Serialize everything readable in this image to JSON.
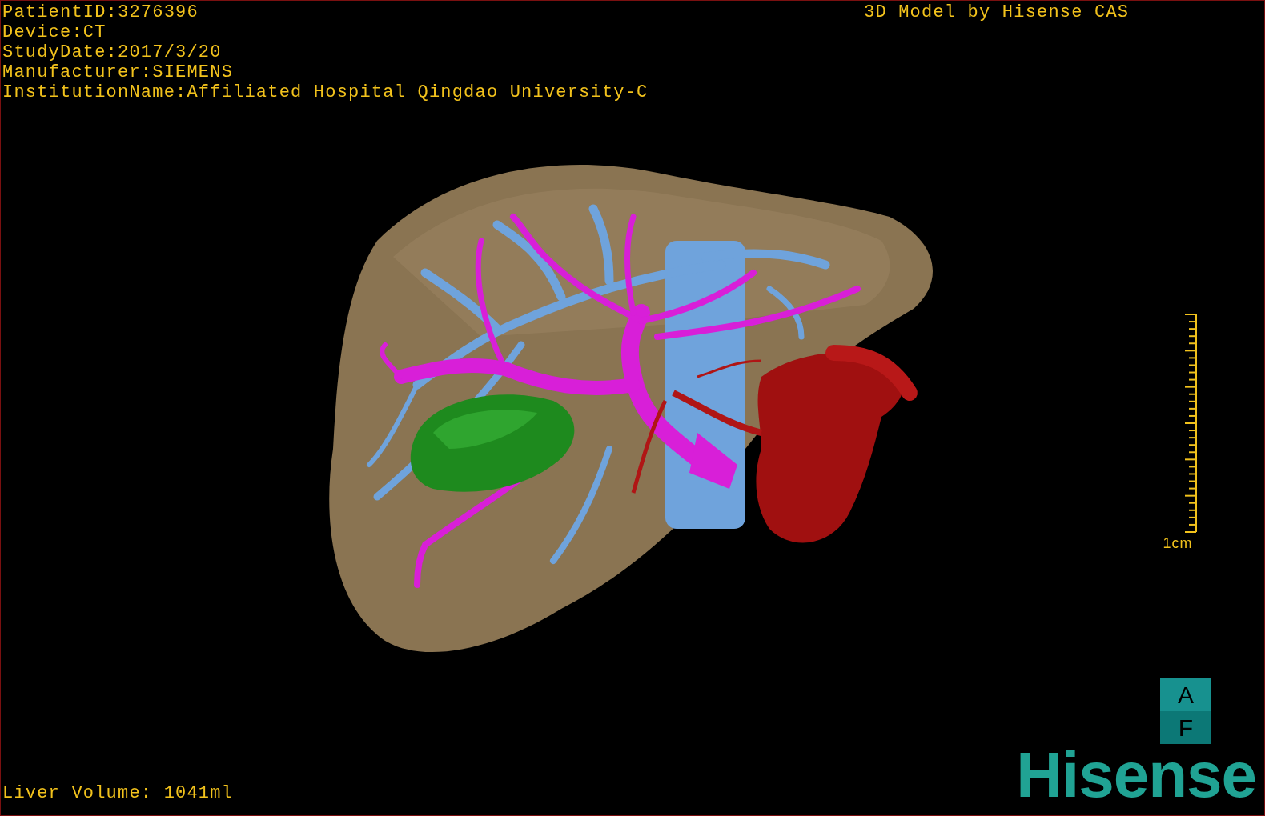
{
  "info_lines": [
    "PatientID:3276396",
    "Device:CT",
    "StudyDate:2017/3/20",
    "Manufacturer:SIEMENS",
    "InstitutionName:Affiliated Hospital Qingdao University-C"
  ],
  "title": "3D Model by Hisense CAS",
  "scale_bar": {
    "label": "1cm"
  },
  "orientation_cube": {
    "top_face": "A",
    "front_face": "F"
  },
  "logo": "Hisense",
  "liver_volume": "Liver Volume: 1041ml"
}
